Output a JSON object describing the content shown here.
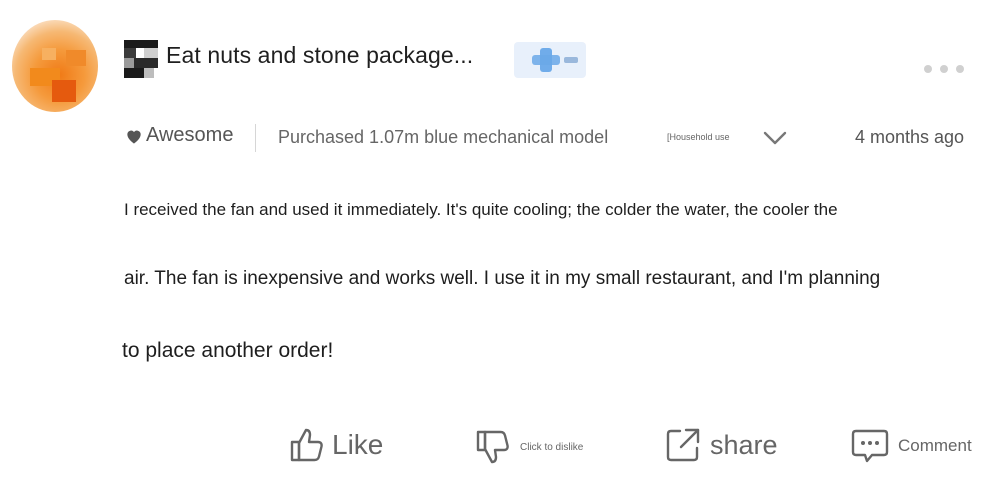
{
  "reviewer": {
    "name": "Eat nuts and stone package..."
  },
  "review": {
    "rating_label": "Awesome",
    "purchased": "Purchased 1.07m blue mechanical model",
    "usage_tag": "[Household use",
    "time_ago": "4 months ago",
    "lines": [
      "I received the fan and used it immediately. It's quite cooling; the colder the water, the cooler the",
      "air. The fan is inexpensive and works well. I use it in my small restaurant, and I'm planning",
      "to place another order!"
    ]
  },
  "actions": {
    "like": "Like",
    "dislike": "Click to dislike",
    "share": "share",
    "comment": "Comment"
  },
  "icons": {
    "heart": "heart-icon",
    "more": "more-dots-icon",
    "expand": "chevron-down-icon",
    "like": "thumbs-up-icon",
    "dislike": "thumbs-down-icon",
    "share": "share-icon",
    "comment": "comment-icon"
  },
  "colors": {
    "text_primary": "#1e1e1e",
    "text_secondary": "#666666",
    "avatar_orange": "#f07a16",
    "badge_blue": "#5aa0e6"
  }
}
